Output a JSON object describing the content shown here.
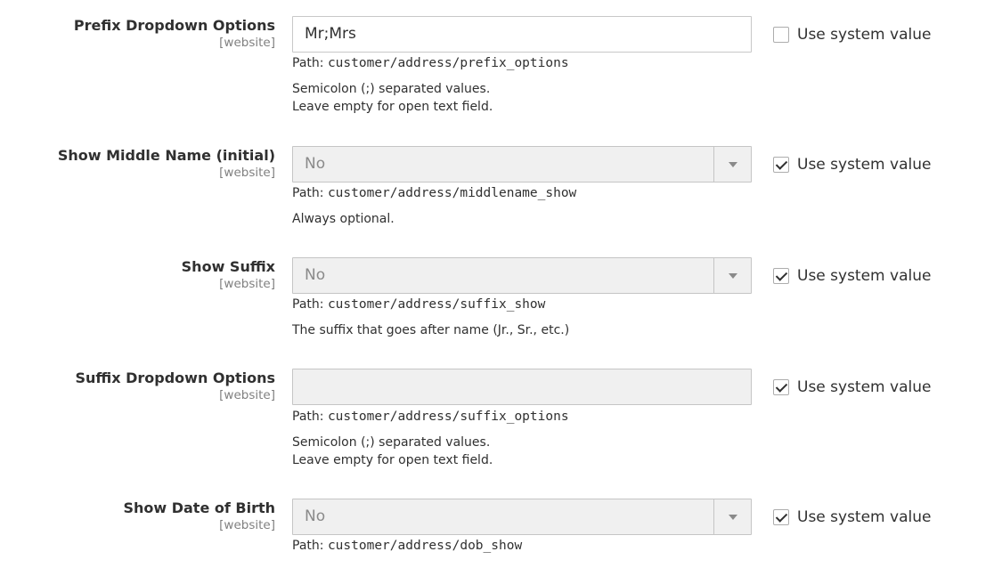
{
  "scope_label": "[website]",
  "use_system_label": "Use system value",
  "path_prefix": "Path:",
  "fields": [
    {
      "label": "Prefix Dropdown Options",
      "type": "text",
      "value": "Mr;Mrs",
      "path": "customer/address/prefix_options",
      "comment_lines": [
        "Semicolon (;) separated values.",
        "Leave empty for open text field."
      ],
      "use_system_checked": false
    },
    {
      "label": "Show Middle Name (initial)",
      "type": "select",
      "value": "No",
      "path": "customer/address/middlename_show",
      "comment_lines": [
        "Always optional."
      ],
      "use_system_checked": true
    },
    {
      "label": "Show Suffix",
      "type": "select",
      "value": "No",
      "path": "customer/address/suffix_show",
      "comment_lines": [
        "The suffix that goes after name (Jr., Sr., etc.)"
      ],
      "use_system_checked": true
    },
    {
      "label": "Suffix Dropdown Options",
      "type": "text",
      "value": "",
      "path": "customer/address/suffix_options",
      "comment_lines": [
        "Semicolon (;) separated values.",
        "Leave empty for open text field."
      ],
      "use_system_checked": true
    },
    {
      "label": "Show Date of Birth",
      "type": "select",
      "value": "No",
      "path": "customer/address/dob_show",
      "comment_lines": [],
      "use_system_checked": true
    }
  ]
}
